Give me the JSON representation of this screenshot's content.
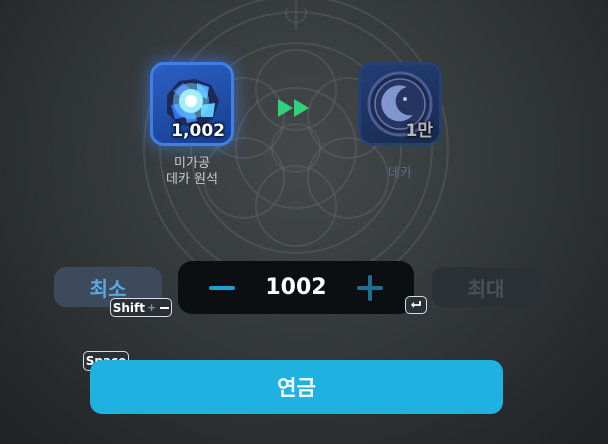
{
  "materials": {
    "input": {
      "name_line1": "미가공",
      "name_line2": "데카 원석",
      "quantity": "1,002",
      "icon": "unprocessed-deca-gem-icon"
    },
    "output": {
      "name": "데카",
      "quantity": "1만",
      "icon": "deca-moon-coin-icon"
    },
    "arrow_icon": "fast-forward-icon"
  },
  "controls": {
    "min_label": "최소",
    "max_label": "최대",
    "amount_value": "1002",
    "minus_icon": "minus-icon",
    "plus_icon": "plus-icon"
  },
  "hotkeys": {
    "shift_label": "Shift",
    "shift_plus": "+",
    "space_label": "Space",
    "enter_icon": "enter-icon"
  },
  "craft_button_label": "연금",
  "colors": {
    "accent": "#1fb1df",
    "stepper_accent": "#1e9fd0",
    "arrow_green": "#2fd27a",
    "input_frame": "#3f7fe6"
  }
}
